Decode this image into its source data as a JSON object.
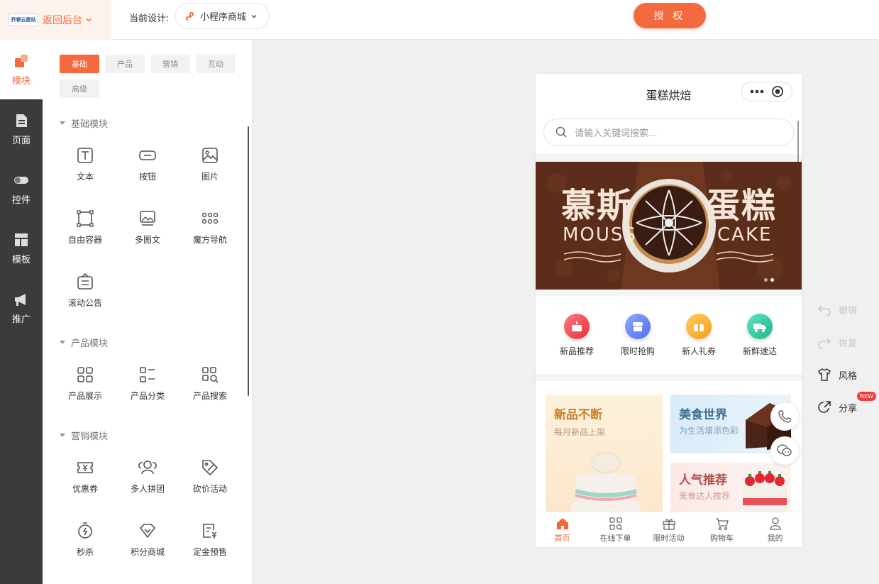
{
  "topbar": {
    "logo_text": "乔顿云建站",
    "back_label": "返回后台",
    "current_design_label": "当前设计:",
    "app_select_value": "小程序商城",
    "authorize_label": "授 权"
  },
  "sidebar": {
    "items": [
      {
        "label": "模块",
        "icon": "module-icon"
      },
      {
        "label": "页面",
        "icon": "page-icon"
      },
      {
        "label": "控件",
        "icon": "toggle-icon"
      },
      {
        "label": "模板",
        "icon": "template-icon"
      },
      {
        "label": "推广",
        "icon": "megaphone-icon"
      }
    ]
  },
  "panel": {
    "tabs": [
      "基础",
      "产品",
      "营销",
      "互动",
      "高级"
    ],
    "sections": [
      {
        "title": "基础模块",
        "modules": [
          "文本",
          "按钮",
          "图片",
          "自由容器",
          "多图文",
          "魔方导航",
          "滚动公告"
        ]
      },
      {
        "title": "产品模块",
        "modules": [
          "产品展示",
          "产品分类",
          "产品搜索"
        ]
      },
      {
        "title": "营销模块",
        "modules": [
          "优惠券",
          "多人拼团",
          "砍价活动",
          "秒杀",
          "积分商城",
          "定金预售"
        ]
      }
    ]
  },
  "phone": {
    "title": "蛋糕烘焙",
    "search_placeholder": "请输入关键词搜索...",
    "banner": {
      "title_left": "慕斯",
      "title_right": "蛋糕",
      "sub_left": "MOUSS",
      "sub_right": "CAKE"
    },
    "quick_icons": [
      {
        "label": "新品推荐",
        "color": "#f0434a"
      },
      {
        "label": "限时抢购",
        "color": "#5a7cf5"
      },
      {
        "label": "新人礼券",
        "color": "#f5a623"
      },
      {
        "label": "新鲜速达",
        "color": "#2fc6a2"
      }
    ],
    "promo": [
      {
        "title": "新品不断",
        "sub": "每月新品上架"
      },
      {
        "title": "美食世界",
        "sub": "为生活增添色彩"
      },
      {
        "title": "人气推荐",
        "sub": "美食达人推荐"
      }
    ],
    "tabbar": [
      "首页",
      "在线下单",
      "限时活动",
      "购物车",
      "我的"
    ]
  },
  "right_tools": {
    "undo": "撤销",
    "redo": "恢复",
    "style": "风格",
    "share": "分享",
    "new_badge": "NEW"
  },
  "colors": {
    "accent": "#f36a3f",
    "sidebar_bg": "#3b3b3b"
  }
}
